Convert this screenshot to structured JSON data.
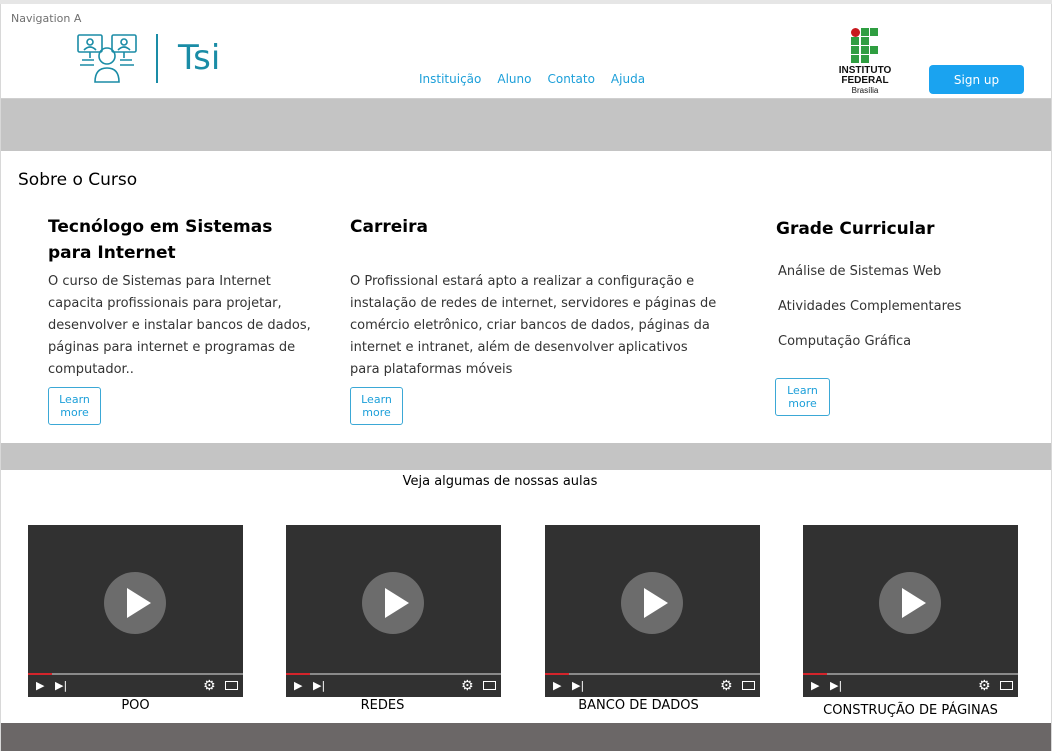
{
  "frame": {
    "label": "Navigation A"
  },
  "header": {
    "logo_text": "Tsi",
    "nav": [
      "Instituição",
      "Aluno",
      "Contato",
      "Ajuda"
    ],
    "institute": {
      "name_line1": "INSTITUTO",
      "name_line2": "FEDERAL",
      "campus": "Brasília"
    },
    "signup_label": "Sign up"
  },
  "about": {
    "title": "Sobre o Curso",
    "columns": [
      {
        "heading": "Tecnólogo em Sistemas para Internet",
        "text": "O curso de Sistemas para Internet capacita profissionais para projetar, desenvolver e instalar bancos de dados, páginas para internet e programas de computador..",
        "learn_label": "Learn more"
      },
      {
        "heading": "Carreira",
        "text": "O Profissional estará  apto a realizar a configuração e instalação de redes de internet, servidores e páginas de comércio eletrônico, criar bancos de dados, páginas da internet e intranet, além de desenvolver aplicativos para plataformas móveis",
        "learn_label": "Learn more"
      },
      {
        "heading": "Grade Curricular",
        "items": [
          "Análise de Sistemas Web",
          "Atividades Complementares",
          "Computação Gráfica"
        ],
        "learn_label": "Learn more"
      }
    ]
  },
  "videos": {
    "title": "Veja  algumas de nossas aulas",
    "items": [
      {
        "label": "POO",
        "progress": 0.11
      },
      {
        "label": "REDES",
        "progress": 0.11
      },
      {
        "label": "BANCO DE DADOS",
        "progress": 0.11
      },
      {
        "label": "CONSTRUÇÃO DE PÁGINAS",
        "progress": 0.11
      }
    ]
  },
  "colors": {
    "accent": "#1aa3f0",
    "brand_teal": "#1a8ca6",
    "band_gray": "#c4c4c4",
    "footer_gray": "#6b6767",
    "if_green": "#2f9e41",
    "if_red": "#c8191e"
  }
}
